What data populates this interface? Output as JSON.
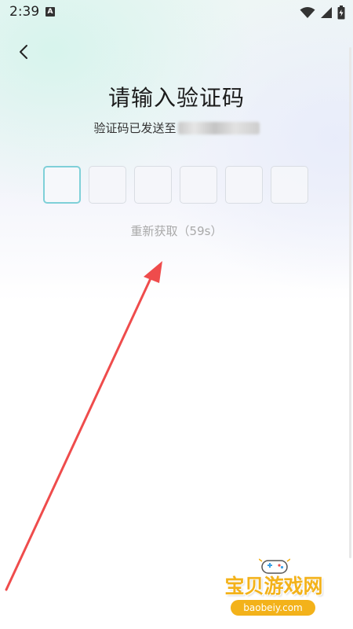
{
  "status_bar": {
    "time": "2:39",
    "notification_badge": "A"
  },
  "page": {
    "title": "请输入验证码",
    "subtitle_prefix": "验证码已发送至",
    "code_boxes": [
      "",
      "",
      "",
      "",
      "",
      ""
    ],
    "resend_text": "重新获取（59s）"
  },
  "watermark": {
    "title": "宝贝游戏网",
    "url": "baobeiy.com"
  },
  "colors": {
    "active_box_border": "#7fd0d8",
    "annotation_arrow": "#ef4c4c",
    "watermark": "#f3b21a"
  },
  "icons": {
    "back": "chevron-left-icon",
    "wifi": "wifi-icon",
    "signal": "cell-signal-icon",
    "battery": "battery-icon"
  }
}
